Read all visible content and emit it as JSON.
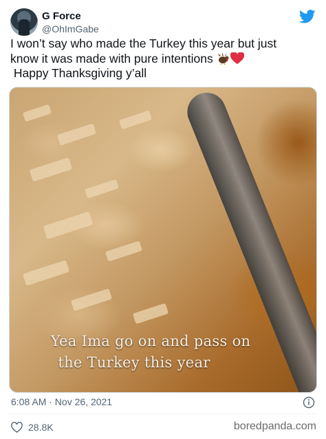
{
  "author": {
    "name": "G Force",
    "handle": "@OhImGabe"
  },
  "tweet": {
    "line1": "I won’t say who made the Turkey this year but just",
    "line2": "know it was made with pure intentions",
    "line3": " Happy Thanksgiving y’all",
    "emojis": [
      "turkey-emoji",
      "red-heart-emoji"
    ]
  },
  "media": {
    "caption_line1": "Yea Ima go on and pass on",
    "caption_line2": "the Turkey this year"
  },
  "meta": {
    "timestamp": "6:08 AM · Nov 26, 2021",
    "likes": "28.8K"
  },
  "watermark": "boredpanda.com",
  "colors": {
    "twitter_blue": "#1d9bf0",
    "secondary_text": "#536471",
    "heart_red": "#e0245e"
  }
}
